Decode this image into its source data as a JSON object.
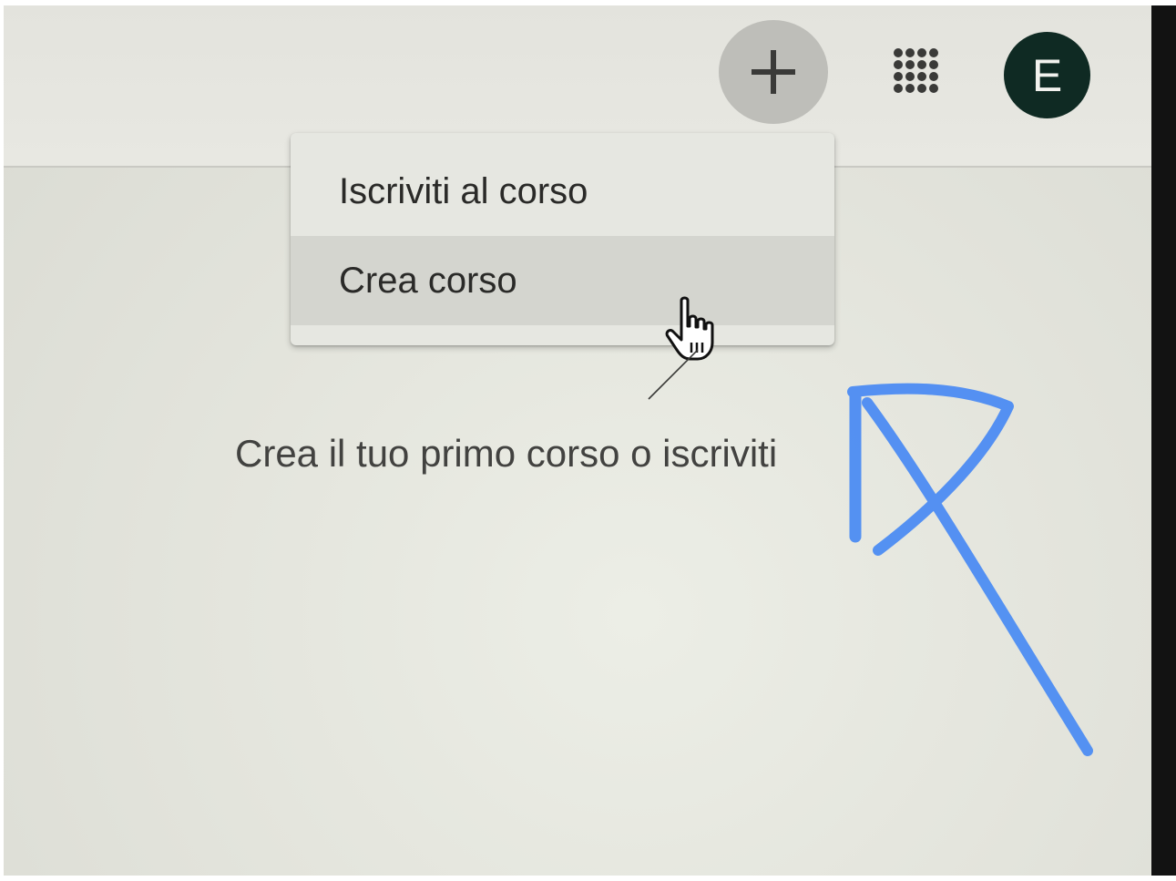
{
  "header": {
    "add_icon": "plus-icon",
    "apps_icon": "apps-grid-icon",
    "avatar_initial": "E"
  },
  "menu": {
    "items": [
      {
        "label": "Iscriviti al corso"
      },
      {
        "label": "Crea corso"
      }
    ],
    "hovered_item": "Crea corso"
  },
  "main": {
    "empty_message": "Crea il tuo primo corso o iscriviti"
  },
  "colors": {
    "avatar_bg": "#0f2a23",
    "add_button_bg": "#bebeb9",
    "annotation_ink": "#3b82f6"
  }
}
